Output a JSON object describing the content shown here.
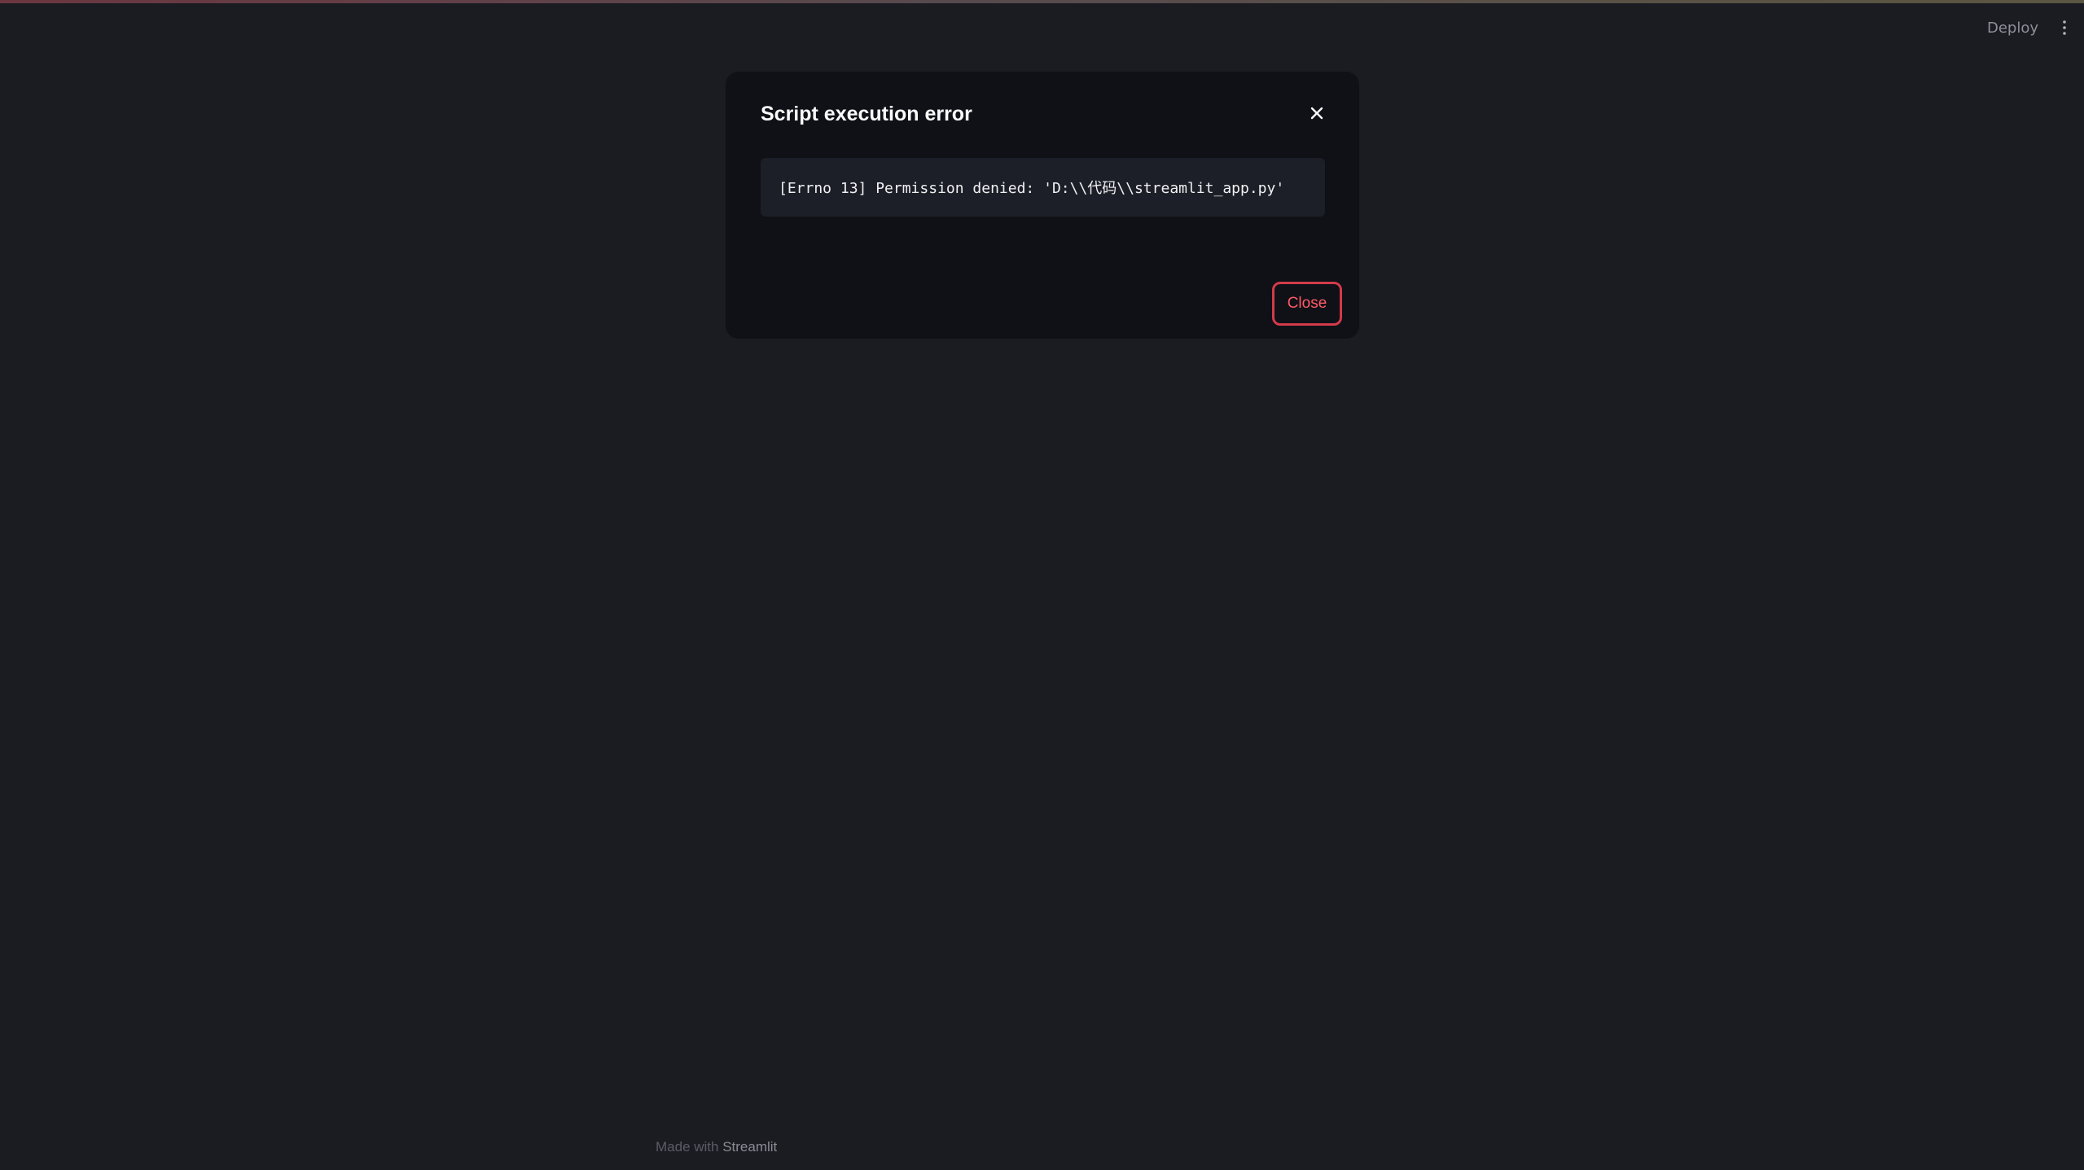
{
  "header": {
    "deploy_label": "Deploy",
    "menu_icon": "kebab-vertical-icon"
  },
  "dialog": {
    "title": "Script execution error",
    "close_icon": "close-icon",
    "error_message": "[Errno 13] Permission denied: 'D:\\\\代码\\\\streamlit_app.py'",
    "close_button_label": "Close"
  },
  "footer": {
    "made_with": "Made with ",
    "brand": "Streamlit"
  },
  "colors": {
    "background": "#1b1c22",
    "dialog_background": "#0f1117",
    "code_background": "#1c1f27",
    "accent_red": "#ff5a66"
  }
}
